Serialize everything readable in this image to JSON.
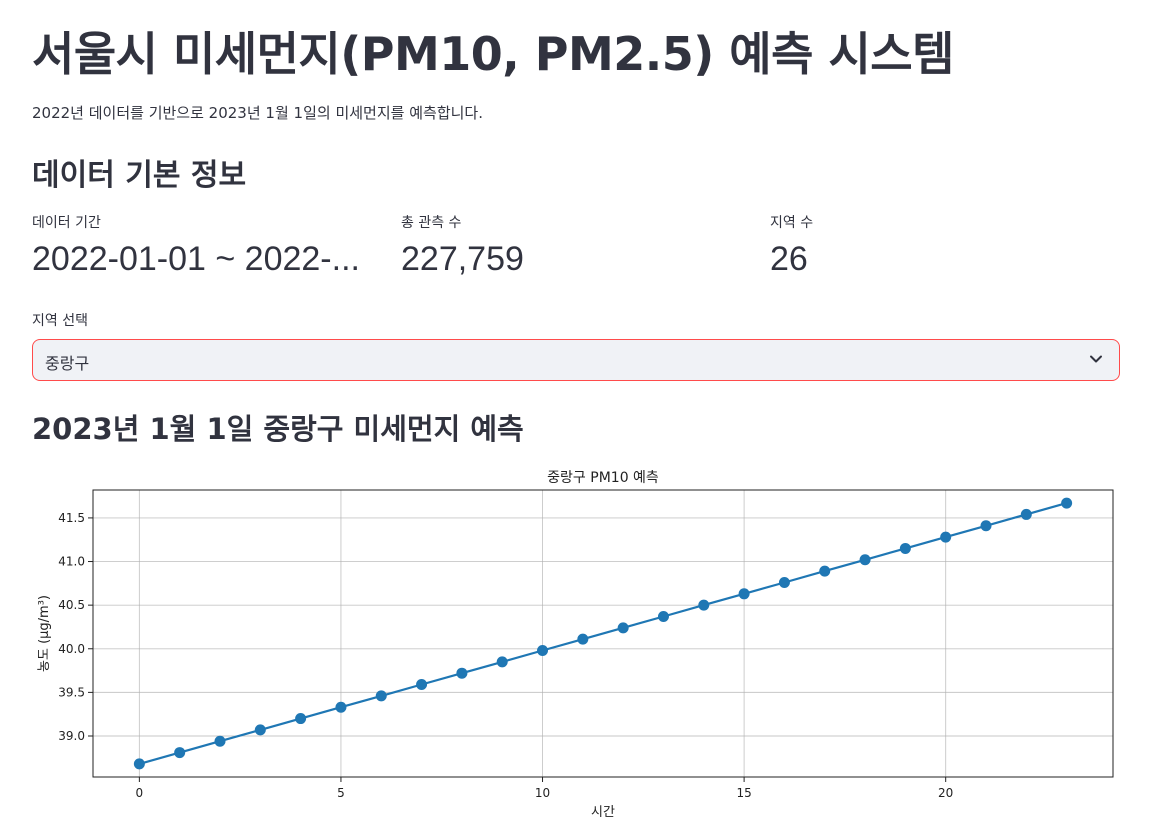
{
  "header": {
    "title": "서울시 미세먼지(PM10, PM2.5) 예측 시스템",
    "description": "2022년 데이터를 기반으로 2023년 1월 1일의 미세먼지를 예측합니다."
  },
  "basic_info": {
    "heading": "데이터 기본 정보",
    "metrics": [
      {
        "label": "데이터 기간",
        "value": "2022-01-01 ~ 2022-..."
      },
      {
        "label": "총 관측 수",
        "value": "227,759"
      },
      {
        "label": "지역 수",
        "value": "26"
      }
    ]
  },
  "region_select": {
    "label": "지역 선택",
    "value": "중랑구",
    "icon": "chevron-down-icon",
    "border_color": "#ff4b4b"
  },
  "forecast": {
    "heading": "2023년 1월 1일 중랑구 미세먼지 예측"
  },
  "colors": {
    "text": "#31333f",
    "line": "#1f77b4",
    "grid": "#b0b0b0",
    "accent": "#ff4b4b"
  },
  "chart_data": {
    "type": "line",
    "title": "중랑구 PM10 예측",
    "xlabel": "시간",
    "ylabel": "농도 (μg/m³)",
    "x": [
      0,
      1,
      2,
      3,
      4,
      5,
      6,
      7,
      8,
      9,
      10,
      11,
      12,
      13,
      14,
      15,
      16,
      17,
      18,
      19,
      20,
      21,
      22,
      23
    ],
    "values": [
      38.68,
      38.81,
      38.94,
      39.07,
      39.2,
      39.33,
      39.46,
      39.59,
      39.72,
      39.85,
      39.98,
      40.11,
      40.24,
      40.37,
      40.5,
      40.63,
      40.76,
      40.89,
      41.02,
      41.15,
      41.28,
      41.41,
      41.54,
      41.67
    ],
    "xlim": [
      -1.15,
      24.15
    ],
    "ylim": [
      38.53,
      41.82
    ],
    "xticks": [
      0,
      5,
      10,
      15,
      20
    ],
    "yticks": [
      39.0,
      39.5,
      40.0,
      40.5,
      41.0,
      41.5
    ],
    "ytick_labels": [
      "39.0",
      "39.5",
      "40.0",
      "40.5",
      "41.0",
      "41.5"
    ],
    "grid": true,
    "marker": "circle"
  }
}
